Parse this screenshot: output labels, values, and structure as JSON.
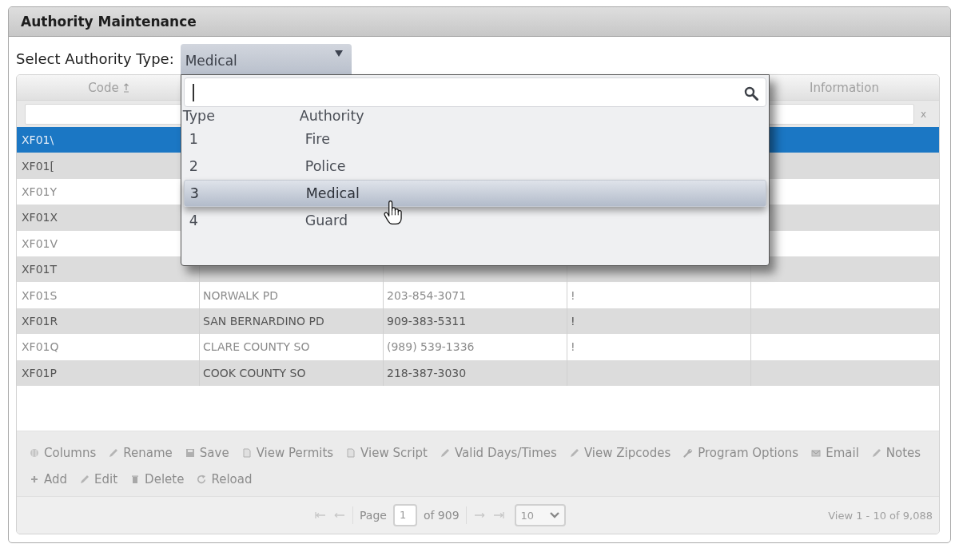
{
  "panel": {
    "title": "Authority Maintenance"
  },
  "type_select": {
    "label": "Select Authority Type:",
    "value": "Medical",
    "expanded": true
  },
  "dropdown": {
    "search_focused": true,
    "columns": [
      "Type",
      "Authority"
    ],
    "options": [
      {
        "type": "1",
        "authority": "Fire",
        "selected": false
      },
      {
        "type": "2",
        "authority": "Police",
        "selected": false
      },
      {
        "type": "3",
        "authority": "Medical",
        "selected": true
      },
      {
        "type": "4",
        "authority": "Guard",
        "selected": false
      }
    ]
  },
  "grid": {
    "columns": [
      {
        "label": "Code",
        "sorted": true
      },
      {
        "label": "Information",
        "sorted": false
      }
    ],
    "filter_clear": "x",
    "rows": [
      {
        "code": "XF01\\",
        "selected": true
      },
      {
        "code": "XF01[",
        "selected": false
      },
      {
        "code": "XF01Y",
        "selected": false
      },
      {
        "code": "XF01X",
        "selected": false
      },
      {
        "code": "XF01V",
        "selected": false
      },
      {
        "code": "XF01T",
        "selected": false
      },
      {
        "code": "XF01S",
        "column_2": "NORWALK PD",
        "column_3": "203-854-3071",
        "column_4": "!",
        "selected": false
      },
      {
        "code": "XF01R",
        "column_2": "SAN BERNARDINO PD",
        "column_3": "909-383-5311",
        "column_4": "!",
        "selected": false
      },
      {
        "code": "XF01Q",
        "column_2": "CLARE COUNTY SO",
        "column_3": "(989) 539-1336",
        "column_4": "!",
        "selected": false
      },
      {
        "code": "XF01P",
        "column_2": "COOK COUNTY SO",
        "column_3": "218-387-3030",
        "selected": false
      }
    ]
  },
  "toolbar": [
    [
      "Columns",
      "Rename",
      "Save",
      "View Permits",
      "View Script",
      "Valid Days/Times",
      "View Zipcodes",
      "Program Options",
      "Email",
      "Notes"
    ],
    [
      "Add",
      "Edit",
      "Delete",
      "Reload"
    ]
  ],
  "pager": {
    "page_label": "Page",
    "page": "1",
    "of_label": "of 909",
    "page_size": "10",
    "summary": "View 1 - 10 of 9,088"
  }
}
